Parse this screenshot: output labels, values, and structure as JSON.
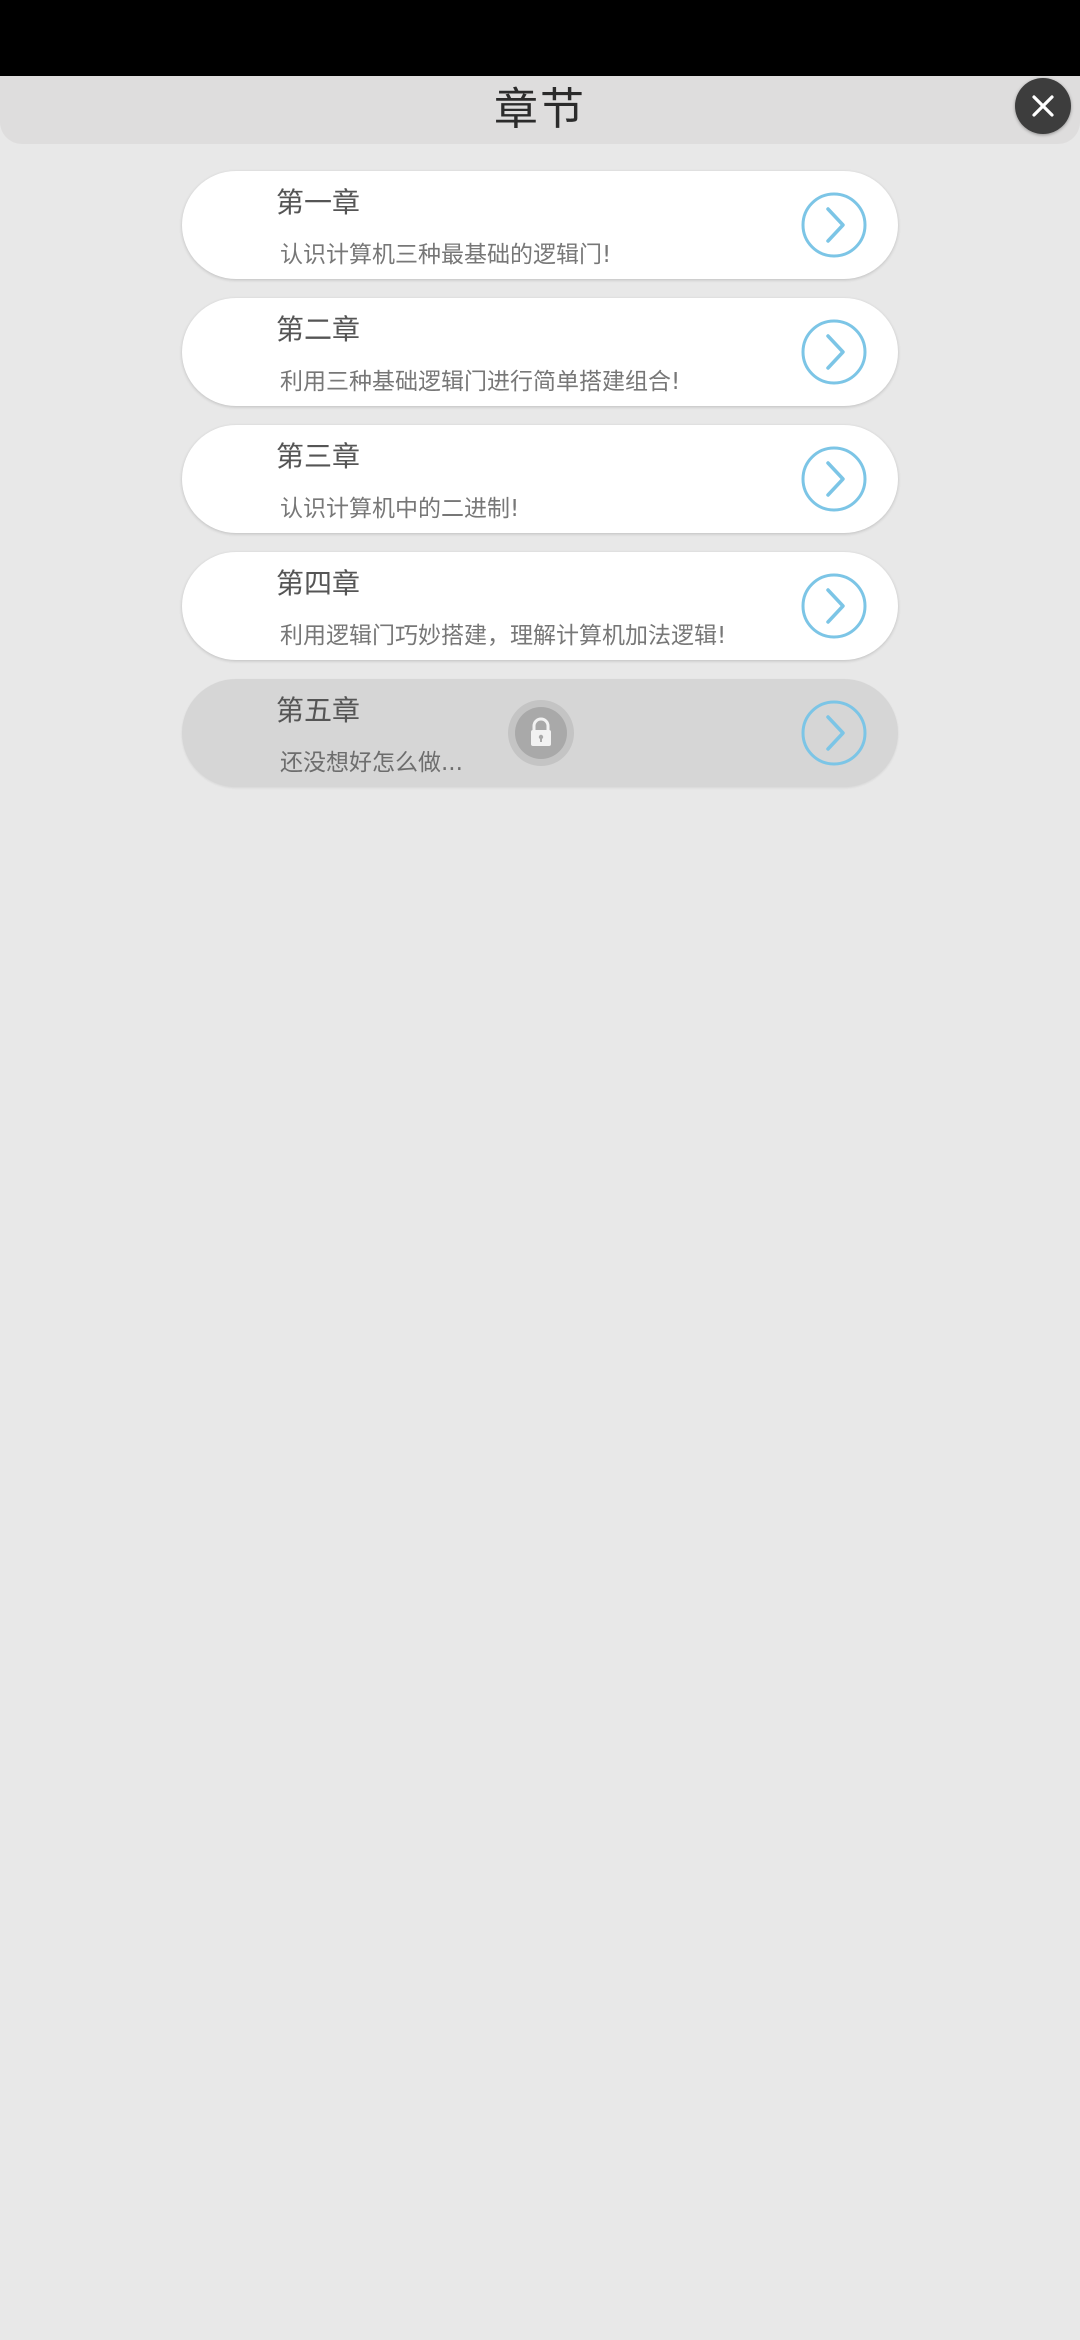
{
  "header": {
    "title": "章节",
    "close_icon": "close-icon"
  },
  "colors": {
    "accent": "#7cc5e6",
    "header_bg": "#dedddd",
    "page_bg": "#e8e8e8",
    "locked_card_bg": "#d6d6d6"
  },
  "chapters": [
    {
      "title": "第一章",
      "description": "认识计算机三种最基础的逻辑门!",
      "locked": false,
      "icon": "chevron-right-icon"
    },
    {
      "title": "第二章",
      "description": "利用三种基础逻辑门进行简单搭建组合!",
      "locked": false,
      "icon": "chevron-right-icon"
    },
    {
      "title": "第三章",
      "description": "认识计算机中的二进制!",
      "locked": false,
      "icon": "chevron-right-icon"
    },
    {
      "title": "第四章",
      "description": "利用逻辑门巧妙搭建，理解计算机加法逻辑!",
      "locked": false,
      "icon": "chevron-right-icon"
    },
    {
      "title": "第五章",
      "description": "还没想好怎么做...",
      "locked": true,
      "icon": "chevron-right-icon",
      "lock_icon": "lock-icon"
    }
  ]
}
